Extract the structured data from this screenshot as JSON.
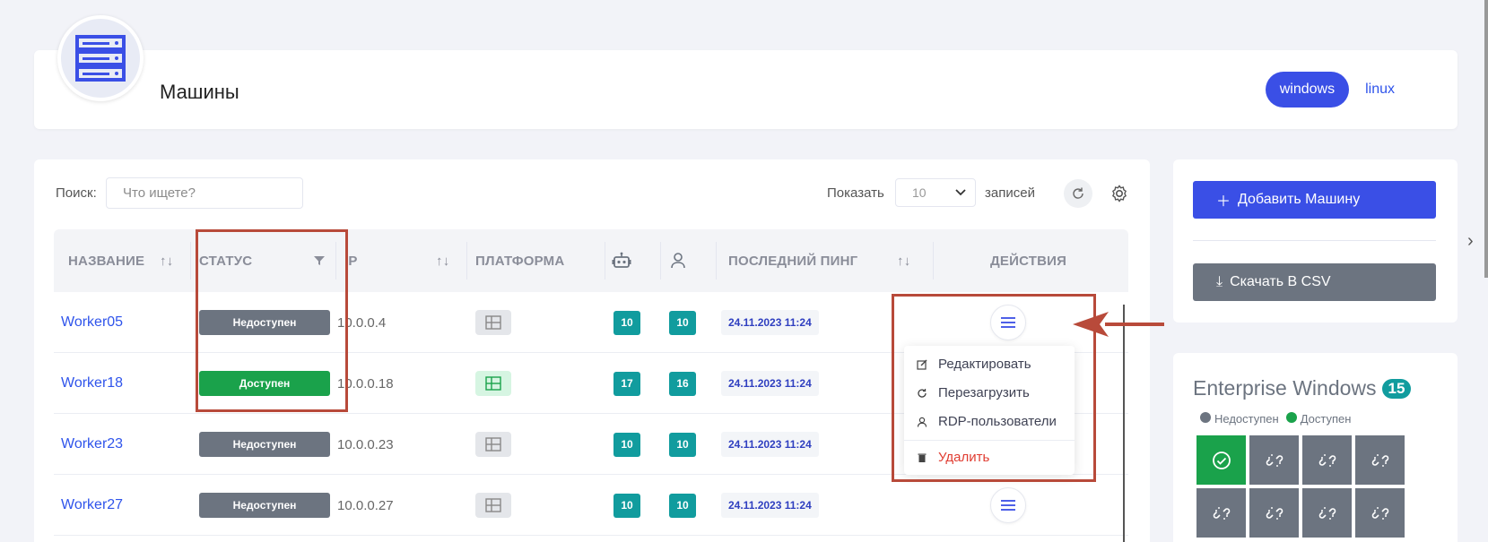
{
  "header": {
    "title": "Машины",
    "platform_tabs": [
      {
        "label": "windows",
        "active": true
      },
      {
        "label": "linux",
        "active": false
      }
    ]
  },
  "toolbar": {
    "search_label": "Поиск:",
    "search_placeholder": "Что ищете?",
    "show_label": "Показать",
    "page_size": "10",
    "records_label": "записей"
  },
  "table": {
    "columns": {
      "name": "НАЗВАНИЕ",
      "status": "СТАТУС",
      "ip": "IP",
      "platform": "ПЛАТФОРМА",
      "last_ping": "ПОСЛЕДНИЙ ПИНГ",
      "actions": "ДЕЙСТВИЯ"
    },
    "rows": [
      {
        "name": "Worker05",
        "status": "Недоступен",
        "status_ok": false,
        "ip": "10.0.0.4",
        "bots": "10",
        "users": "10",
        "last_ping": "24.11.2023 11:24"
      },
      {
        "name": "Worker18",
        "status": "Доступен",
        "status_ok": true,
        "ip": "10.0.0.18",
        "bots": "17",
        "users": "16",
        "last_ping": "24.11.2023 11:24"
      },
      {
        "name": "Worker23",
        "status": "Недоступен",
        "status_ok": false,
        "ip": "10.0.0.23",
        "bots": "10",
        "users": "10",
        "last_ping": "24.11.2023 11:24"
      },
      {
        "name": "Worker27",
        "status": "Недоступен",
        "status_ok": false,
        "ip": "10.0.0.27",
        "bots": "10",
        "users": "10",
        "last_ping": "24.11.2023 11:24"
      }
    ]
  },
  "action_menu": {
    "edit": "Редактировать",
    "restart": "Перезагрузить",
    "rdp_users": "RDP-пользователи",
    "delete": "Удалить"
  },
  "sidebar": {
    "add_button": "Добавить Машину",
    "csv_button": "Скачать В CSV",
    "pool": {
      "title": "Enterprise Windows",
      "count": "15",
      "legend_unavailable": "Недоступен",
      "legend_available": "Доступен",
      "tiles_available": [
        true,
        false,
        false,
        false,
        false,
        false,
        false,
        false
      ]
    }
  },
  "colors": {
    "primary": "#3a4fe6",
    "success": "#1aa24b",
    "muted": "#6c7480",
    "teal": "#119c9e",
    "annotation": "#b84a3a"
  }
}
